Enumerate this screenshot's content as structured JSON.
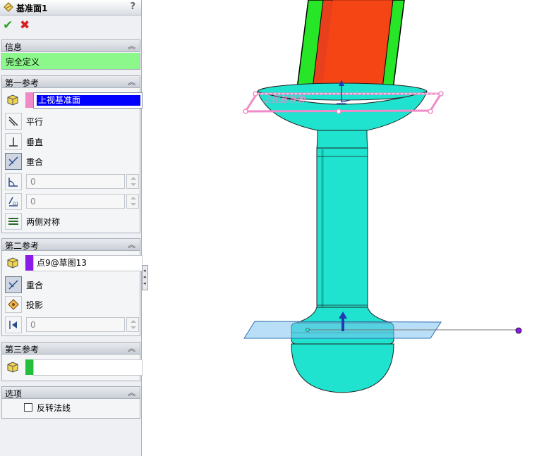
{
  "panel": {
    "title": "基准面1",
    "help": "?",
    "ok": "✔",
    "cancel": "✖"
  },
  "info": {
    "header": "信息",
    "status": "完全定义"
  },
  "first_ref": {
    "header": "第一参考",
    "selection": "上视基准面",
    "options": [
      "平行",
      "垂直",
      "重合"
    ],
    "angle_value": "0",
    "distance_value": "0",
    "symmetric_label": "两侧对称"
  },
  "second_ref": {
    "header": "第二参考",
    "selection": "点9@草图13",
    "options": [
      "重合",
      "投影"
    ],
    "value": "0"
  },
  "third_ref": {
    "header": "第三参考",
    "selection": ""
  },
  "options": {
    "header": "选项",
    "flip_normal": "反转法线"
  },
  "viewport": {
    "plane_label": "上视基准面"
  },
  "colors": {
    "first_ref_marker": "#f08ac8",
    "second_ref_marker": "#8a1be8",
    "third_ref_marker": "#22c03a",
    "info_status_bg": "#8cf88c",
    "part_cyan": "#1fe3cf",
    "part_red": "#e8401c",
    "part_green": "#27e627"
  }
}
